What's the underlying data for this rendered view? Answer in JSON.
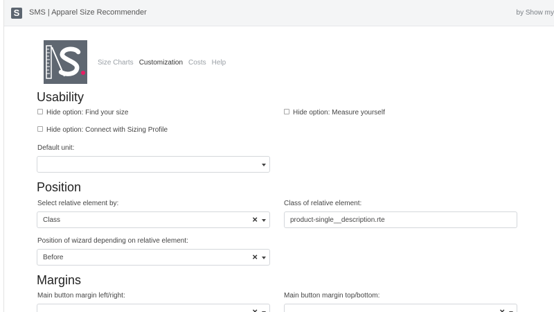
{
  "header": {
    "app_badge": "S",
    "title": "SMS | Apparel Size Recommender",
    "by": "by Show my"
  },
  "nav": {
    "items": [
      "Size Charts",
      "Customization",
      "Costs",
      "Help"
    ],
    "active_index": 1
  },
  "colors": {
    "logo_bg": "#5f6771",
    "logo_dot": "#e91e63"
  },
  "usability": {
    "title": "Usability",
    "hide_find_size": "Hide option: Find your size",
    "hide_measure_yourself": "Hide option: Measure yourself",
    "hide_connect_profile": "Hide option: Connect with Sizing Profile",
    "default_unit_label": "Default unit:",
    "default_unit_value": ""
  },
  "position": {
    "title": "Position",
    "select_by_label": "Select relative element by:",
    "select_by_value": "Class",
    "class_label": "Class of relative element:",
    "class_value": "product-single__description.rte",
    "wizard_position_label": "Position of wizard depending on relative element:",
    "wizard_position_value": "Before"
  },
  "margins": {
    "title": "Margins",
    "left_right_label": "Main button margin left/right:",
    "top_bottom_label": "Main button margin top/bottom:"
  }
}
